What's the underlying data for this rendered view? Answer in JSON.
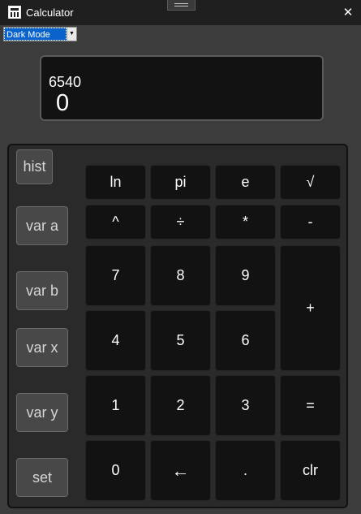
{
  "window": {
    "title": "Calculator",
    "icon": "calculator-icon"
  },
  "theme_select": {
    "value": "Dark Mode"
  },
  "display": {
    "expression": "6540",
    "result": "0"
  },
  "side_buttons": {
    "hist": "hist",
    "var_a": "var a",
    "var_b": "var b",
    "var_x": "var x",
    "var_y": "var y",
    "set": "set"
  },
  "keys": {
    "ln": "ln",
    "pi": "pi",
    "e": "e",
    "sqrt": "√",
    "pow": "^",
    "divide": "÷",
    "multiply": "*",
    "minus": "-",
    "seven": "7",
    "eight": "8",
    "nine": "9",
    "plus": "+",
    "four": "4",
    "five": "5",
    "six": "6",
    "one": "1",
    "two": "2",
    "three": "3",
    "equals": "=",
    "zero": "0",
    "backspace": "←",
    "dot": ".",
    "clr": "clr"
  },
  "colors": {
    "background": "#3c3c3c",
    "titlebar": "#1f1f1f",
    "key": "#121212",
    "side_key": "#484848",
    "selection": "#0a63cc"
  }
}
